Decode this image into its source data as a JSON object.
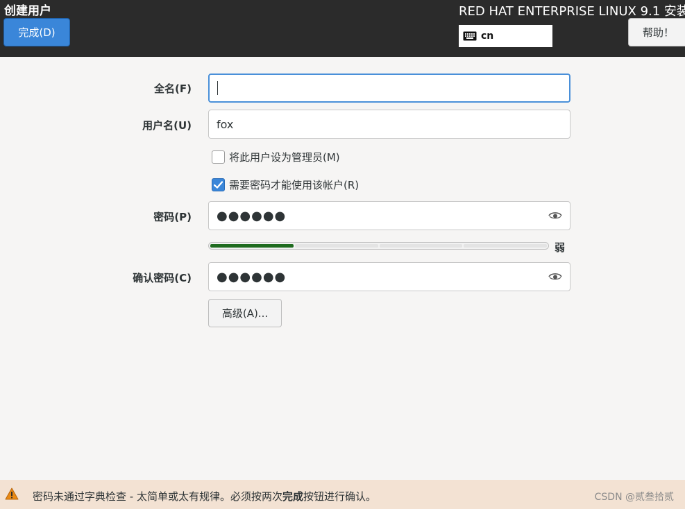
{
  "header": {
    "title": "创建用户",
    "done_label": "完成(D)",
    "product": "RED HAT ENTERPRISE LINUX 9.1 安装",
    "keyboard_layout": "cn",
    "help_label": "帮助！"
  },
  "form": {
    "fullname": {
      "label": "全名(F)",
      "value": ""
    },
    "username": {
      "label": "用户名(U)",
      "value": "fox"
    },
    "admin_checkbox": {
      "label": "将此用户设为管理员(M)",
      "checked": false
    },
    "require_password_checkbox": {
      "label": "需要密码才能使用该帐户(R)",
      "checked": true
    },
    "password": {
      "label": "密码(P)",
      "masked": "●●●●●●"
    },
    "strength": {
      "label": "弱",
      "level": 0.25
    },
    "confirm": {
      "label": "确认密码(C)",
      "masked": "●●●●●●"
    },
    "advanced_label": "高级(A)..."
  },
  "warning": {
    "text_before": "密码未通过字典检查 - 太简单或太有规律。必须按两次",
    "text_bold": "完成",
    "text_after": "按钮进行确认。"
  },
  "watermark": "CSDN @贰叁拾贰",
  "colors": {
    "header_bg": "#2b2b2b",
    "accent": "#3a86d9",
    "strength_fill": "#1f6b1f",
    "warning_bg": "#f3e2d3"
  }
}
